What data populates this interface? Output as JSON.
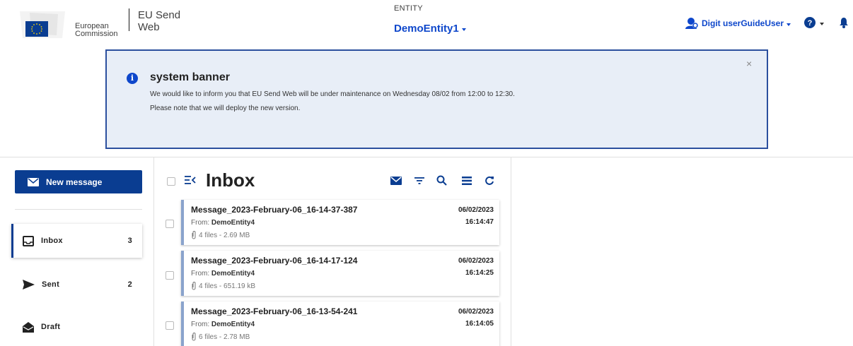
{
  "header": {
    "org_line1": "European",
    "org_line2": "Commission",
    "app_line1": "EU Send",
    "app_line2": "Web",
    "entity_caption": "ENTITY",
    "entity_name": "DemoEntity1",
    "user_name": "Digit userGuideUser",
    "icons": [
      "user-icon",
      "help-icon",
      "bell-icon"
    ]
  },
  "banner": {
    "title": "system banner",
    "line1": "We would like to inform you that EU Send Web will be under maintenance on Wednesday 08/02 from 12:00 to 12:30.",
    "line2": "Please note that we will deploy the new version.",
    "close": "×"
  },
  "sidebar": {
    "new_message_label": "New message",
    "items": [
      {
        "label": "Inbox",
        "count": "3",
        "icon": "inbox-icon"
      },
      {
        "label": "Sent",
        "count": "2",
        "icon": "send-icon"
      },
      {
        "label": "Draft",
        "count": "",
        "icon": "draft-icon"
      }
    ]
  },
  "inbox": {
    "title": "Inbox",
    "messages": [
      {
        "subject": "Message_2023-February-06_16-14-37-387",
        "from_label": "From: ",
        "from": "DemoEntity4",
        "files": "4 files - 2.69 MB",
        "date": "06/02/2023",
        "time": "16:14:47"
      },
      {
        "subject": "Message_2023-February-06_16-14-17-124",
        "from_label": "From: ",
        "from": "DemoEntity4",
        "files": "4 files - 651.19 kB",
        "date": "06/02/2023",
        "time": "16:14:25"
      },
      {
        "subject": "Message_2023-February-06_16-13-54-241",
        "from_label": "From: ",
        "from": "DemoEntity4",
        "files": "6 files - 2.78 MB",
        "date": "06/02/2023",
        "time": "16:14:05"
      }
    ]
  },
  "colors": {
    "accent": "#0e47cb",
    "primary_button": "#0a3d91",
    "banner_border": "#2b4f9e",
    "banner_bg": "#e8eef7"
  }
}
